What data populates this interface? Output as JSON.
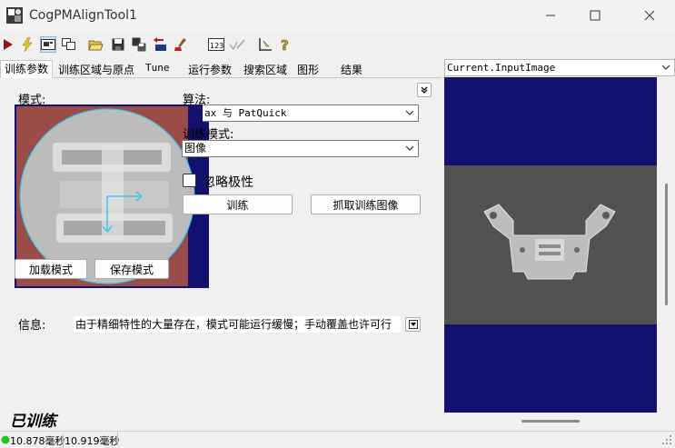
{
  "window": {
    "title": "CogPMAlignTool1"
  },
  "tabs": [
    {
      "label": "训练参数"
    },
    {
      "label": "训练区域与原点"
    },
    {
      "label": "Tune"
    },
    {
      "label": "运行参数"
    },
    {
      "label": "搜索区域"
    },
    {
      "label": "图形"
    },
    {
      "label": "结果"
    }
  ],
  "train_params": {
    "pattern_label": "模式:",
    "algorithm_label": "算法:",
    "algorithm_value": "ax 与 PatQuick",
    "train_mode_label": "训练模式:",
    "train_mode_value": "图像",
    "ignore_polarity_label": "忽略极性",
    "ignore_polarity_checked": false,
    "train_button": "训练",
    "grab_train_image_button": "抓取训练图像",
    "load_pattern_button": "加载模式",
    "save_pattern_button": "保存模式",
    "info_label": "信息:",
    "info_text": "由于精细特性的大量存在，模式可能运行缓慢；手动覆盖也许可行",
    "trained_status": "已训练"
  },
  "image_view": {
    "selector_value": "Current.InputImage"
  },
  "status_bar": {
    "time1": "10.878毫秒",
    "time2": "10.919毫秒",
    "indicator_color": "#22c322"
  },
  "colors": {
    "navy_bg": "#12126e",
    "pattern_red": "#9a4c48",
    "accent_cyan": "#38c8e8"
  },
  "icons": [
    "run-icon",
    "electric-run-icon",
    "display-icon",
    "window-icon",
    "open-folder-icon",
    "save-icon",
    "save-as-icon",
    "import-icon",
    "reset-icon",
    "numeric-123-icon",
    "edit-disabled-icon",
    "tool-edit-icon",
    "help-icon"
  ]
}
